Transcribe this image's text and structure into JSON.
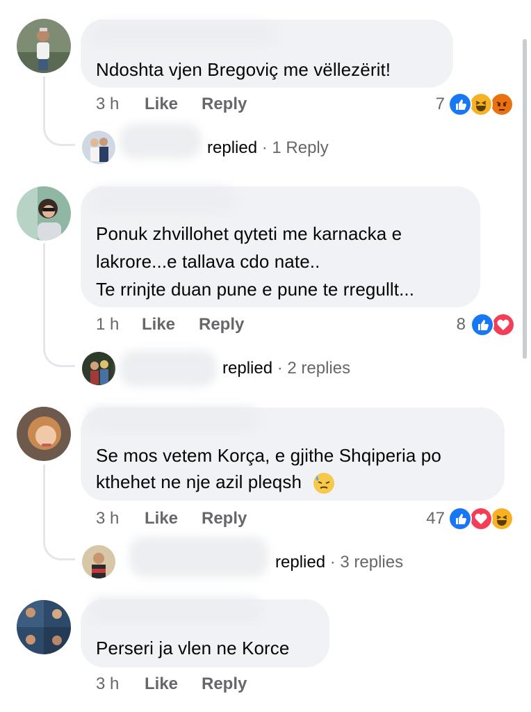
{
  "comments": [
    {
      "text_lines": [
        "Ndoshta vjen Bregoviç me vëllezërit!"
      ],
      "time": "3 h",
      "like": "Like",
      "reply": "Reply",
      "reaction_count": "7",
      "reactions": [
        "like-icon",
        "haha-icon",
        "angry-icon"
      ],
      "thread": {
        "replied": "replied",
        "sep": "·",
        "count": "1 Reply"
      }
    },
    {
      "text_lines": [
        "Ponuk zhvillohet qyteti me karnacka e",
        "lakrore...e tallava cdo nate..",
        "Te rrinjte duan pune e pune te rregullt..."
      ],
      "time": "1 h",
      "like": "Like",
      "reply": "Reply",
      "reaction_count": "8",
      "reactions": [
        "like-icon",
        "love-icon"
      ],
      "thread": {
        "replied": "replied",
        "sep": "·",
        "count": "2 replies"
      }
    },
    {
      "text_lines": [
        "Se mos vetem Korça, e gjithe Shqiperia po",
        "kthehet ne nje azil pleqsh"
      ],
      "time": "3 h",
      "like": "Like",
      "reply": "Reply",
      "reaction_count": "47",
      "reactions": [
        "like-icon",
        "love-icon",
        "haha-icon"
      ],
      "thread": {
        "replied": "replied",
        "sep": "·",
        "count": "3 replies"
      }
    },
    {
      "text_lines": [
        "Perseri ja vlen ne Korce"
      ],
      "time": "3 h",
      "like": "Like",
      "reply": "Reply"
    }
  ],
  "colors": {
    "like": "#1877f2",
    "love": "#f33e58",
    "haha": "#f7b125",
    "angry": "#e9710f",
    "bubble": "#f0f2f5",
    "meta": "#65676b"
  }
}
